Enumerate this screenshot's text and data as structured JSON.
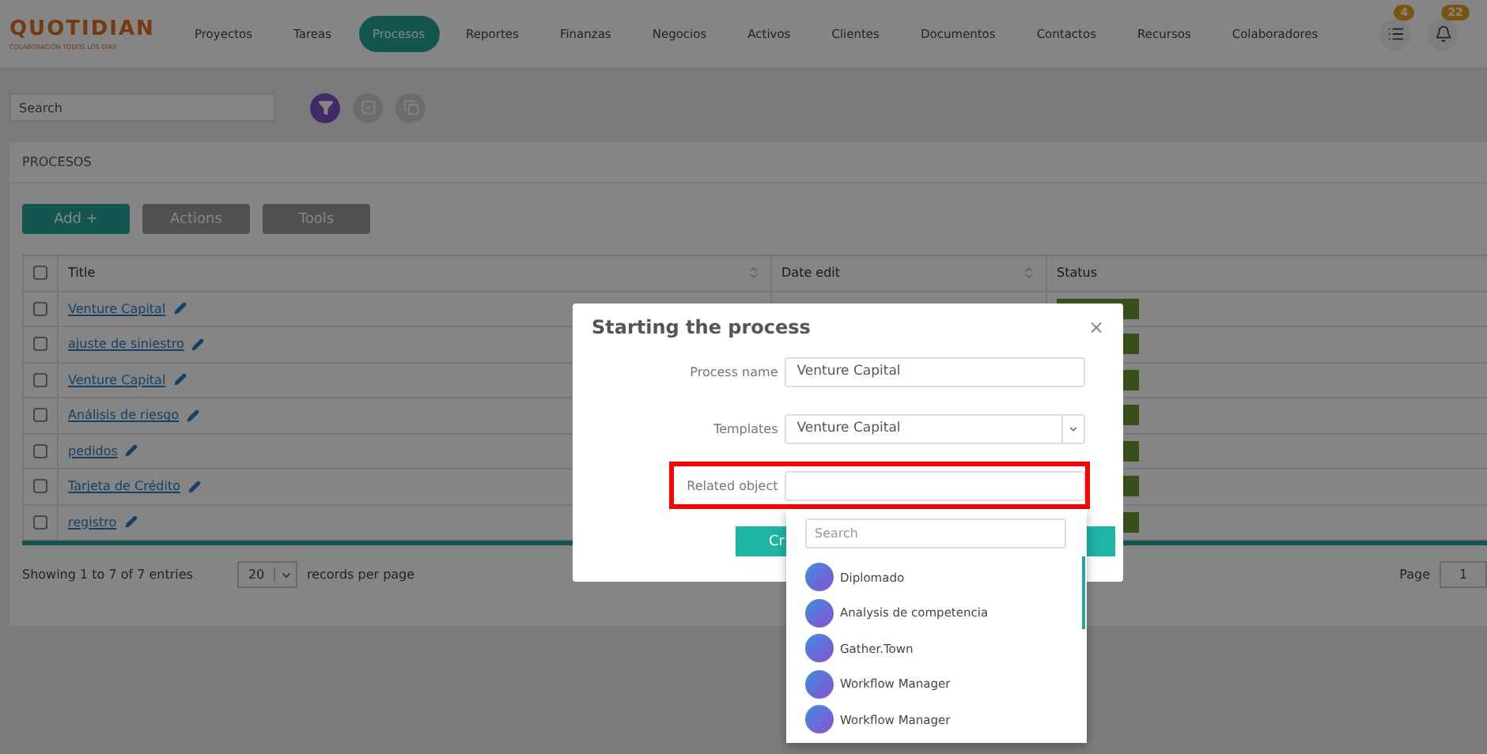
{
  "header": {
    "logo": "QUOTIDIAN",
    "tagline": "COLABORACIÓN TODOS LOS DÍAS",
    "nav": [
      {
        "label": "Proyectos",
        "selected": false
      },
      {
        "label": "Tareas",
        "selected": false
      },
      {
        "label": "Procesos",
        "selected": true
      },
      {
        "label": "Reportes",
        "selected": false
      },
      {
        "label": "Finanzas",
        "selected": false
      },
      {
        "label": "Negocios",
        "selected": false
      },
      {
        "label": "Activos",
        "selected": false
      },
      {
        "label": "Clientes",
        "selected": false
      },
      {
        "label": "Documentos",
        "selected": false
      },
      {
        "label": "Contactos",
        "selected": false
      },
      {
        "label": "Recursos",
        "selected": false
      },
      {
        "label": "Colaboradores",
        "selected": false
      }
    ],
    "message_count": "4",
    "notification_count": "22"
  },
  "search": {
    "placeholder": "Search"
  },
  "panel": {
    "title": "PROCESOS",
    "buttons": [
      {
        "label": "Add +",
        "kind": "primary"
      },
      {
        "label": "Actions",
        "kind": "secondary"
      },
      {
        "label": "Tools",
        "kind": "secondary"
      }
    ],
    "table": {
      "columns": [
        "Title",
        "Date edit",
        "Status"
      ],
      "header_checked": false,
      "rows": [
        {
          "checked": false,
          "title": "Venture Capital"
        },
        {
          "checked": false,
          "title": "ajuste de siniestro"
        },
        {
          "checked": false,
          "title": "Venture Capital"
        },
        {
          "checked": false,
          "title": "Análisis de riesgo"
        },
        {
          "checked": false,
          "title": "pedidos"
        },
        {
          "checked": false,
          "title": "Tarjeta de Crédito"
        },
        {
          "checked": false,
          "title": "registro"
        }
      ]
    },
    "footer": {
      "info": "Showing 1 to 7 of 7 entries",
      "page_size": "20",
      "page_size_label": "records per page",
      "page_label": "Page",
      "page": "1"
    }
  },
  "modal": {
    "title": "Starting the process",
    "close": "×",
    "fields": [
      {
        "label": "Process name",
        "value": "Venture Capital",
        "kind": "text",
        "highlighted": false
      },
      {
        "label": "Templates",
        "value": "Venture Capital",
        "kind": "select",
        "highlighted": false
      },
      {
        "label": "Related object",
        "kind": "lookup",
        "highlighted": true
      }
    ],
    "submit": "Cr"
  },
  "dropdown": {
    "search": {
      "placeholder": "Search"
    },
    "items": [
      {
        "label": "Diplomado"
      },
      {
        "label": "Analysis de competencia"
      },
      {
        "label": "Gather.Town"
      },
      {
        "label": "Workflow Manager"
      },
      {
        "label": "Workflow Manager"
      }
    ]
  }
}
